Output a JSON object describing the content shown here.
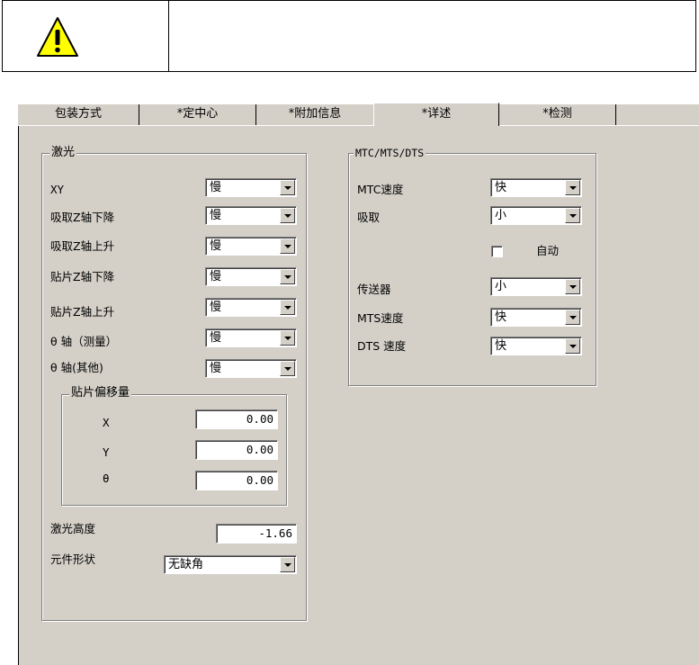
{
  "tabs": [
    {
      "label": "包装方式"
    },
    {
      "label": "*定中心"
    },
    {
      "label": "*附加信息"
    },
    {
      "label": "*详述"
    },
    {
      "label": "*检测"
    }
  ],
  "laser_group": {
    "title": "激光",
    "rows": [
      {
        "label": "XY",
        "value": "慢"
      },
      {
        "label": "吸取Z轴下降",
        "value": "慢"
      },
      {
        "label": "吸取Z轴上升",
        "value": "慢"
      },
      {
        "label": "贴片Z轴下降",
        "value": "慢"
      },
      {
        "label": "贴片Z轴上升",
        "value": "慢"
      },
      {
        "label": "θ 轴（测量）",
        "value": "慢"
      },
      {
        "label": "θ 轴(其他)",
        "value": "慢"
      }
    ],
    "offset_group": {
      "title": "贴片偏移量",
      "rows": [
        {
          "label": "X",
          "value": "0.00"
        },
        {
          "label": "Y",
          "value": "0.00"
        },
        {
          "label": "θ",
          "value": "0.00"
        }
      ]
    },
    "laser_height_label": "激光高度",
    "laser_height_value": "-1.66",
    "shape_label": "元件形状",
    "shape_value": "无缺角"
  },
  "mtc_group": {
    "title": "MTC/MTS/DTS",
    "mtc_speed_label": "MTC速度",
    "mtc_speed_value": "快",
    "pickup_label": "吸取",
    "pickup_value": "小",
    "auto_label": "自动",
    "auto_checked": false,
    "conveyor_label": "传送器",
    "conveyor_value": "小",
    "mts_speed_label": "MTS速度",
    "mts_speed_value": "快",
    "dts_speed_label": "DTS 速度",
    "dts_speed_value": "快"
  }
}
